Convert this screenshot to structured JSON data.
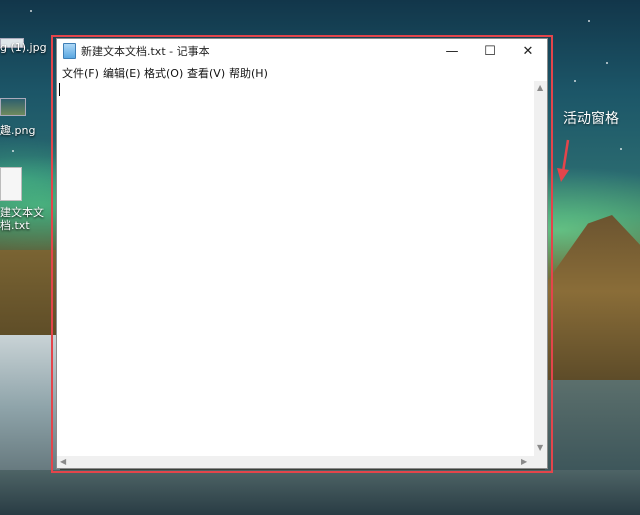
{
  "desktop": {
    "icons": [
      {
        "label": "g (1).jpg"
      },
      {
        "label": "趣.png"
      },
      {
        "label_line1": "建文本文",
        "label_line2": "档.txt"
      }
    ]
  },
  "window": {
    "title": "新建文本文档.txt - 记事本",
    "controls": {
      "minimize": "—",
      "maximize": "☐",
      "close": "✕"
    },
    "menu": [
      "文件(F)",
      "编辑(E)",
      "格式(O)",
      "查看(V)",
      "帮助(H)"
    ],
    "content": ""
  },
  "annotation": {
    "label": "活动窗格",
    "color": "#e4454b"
  }
}
